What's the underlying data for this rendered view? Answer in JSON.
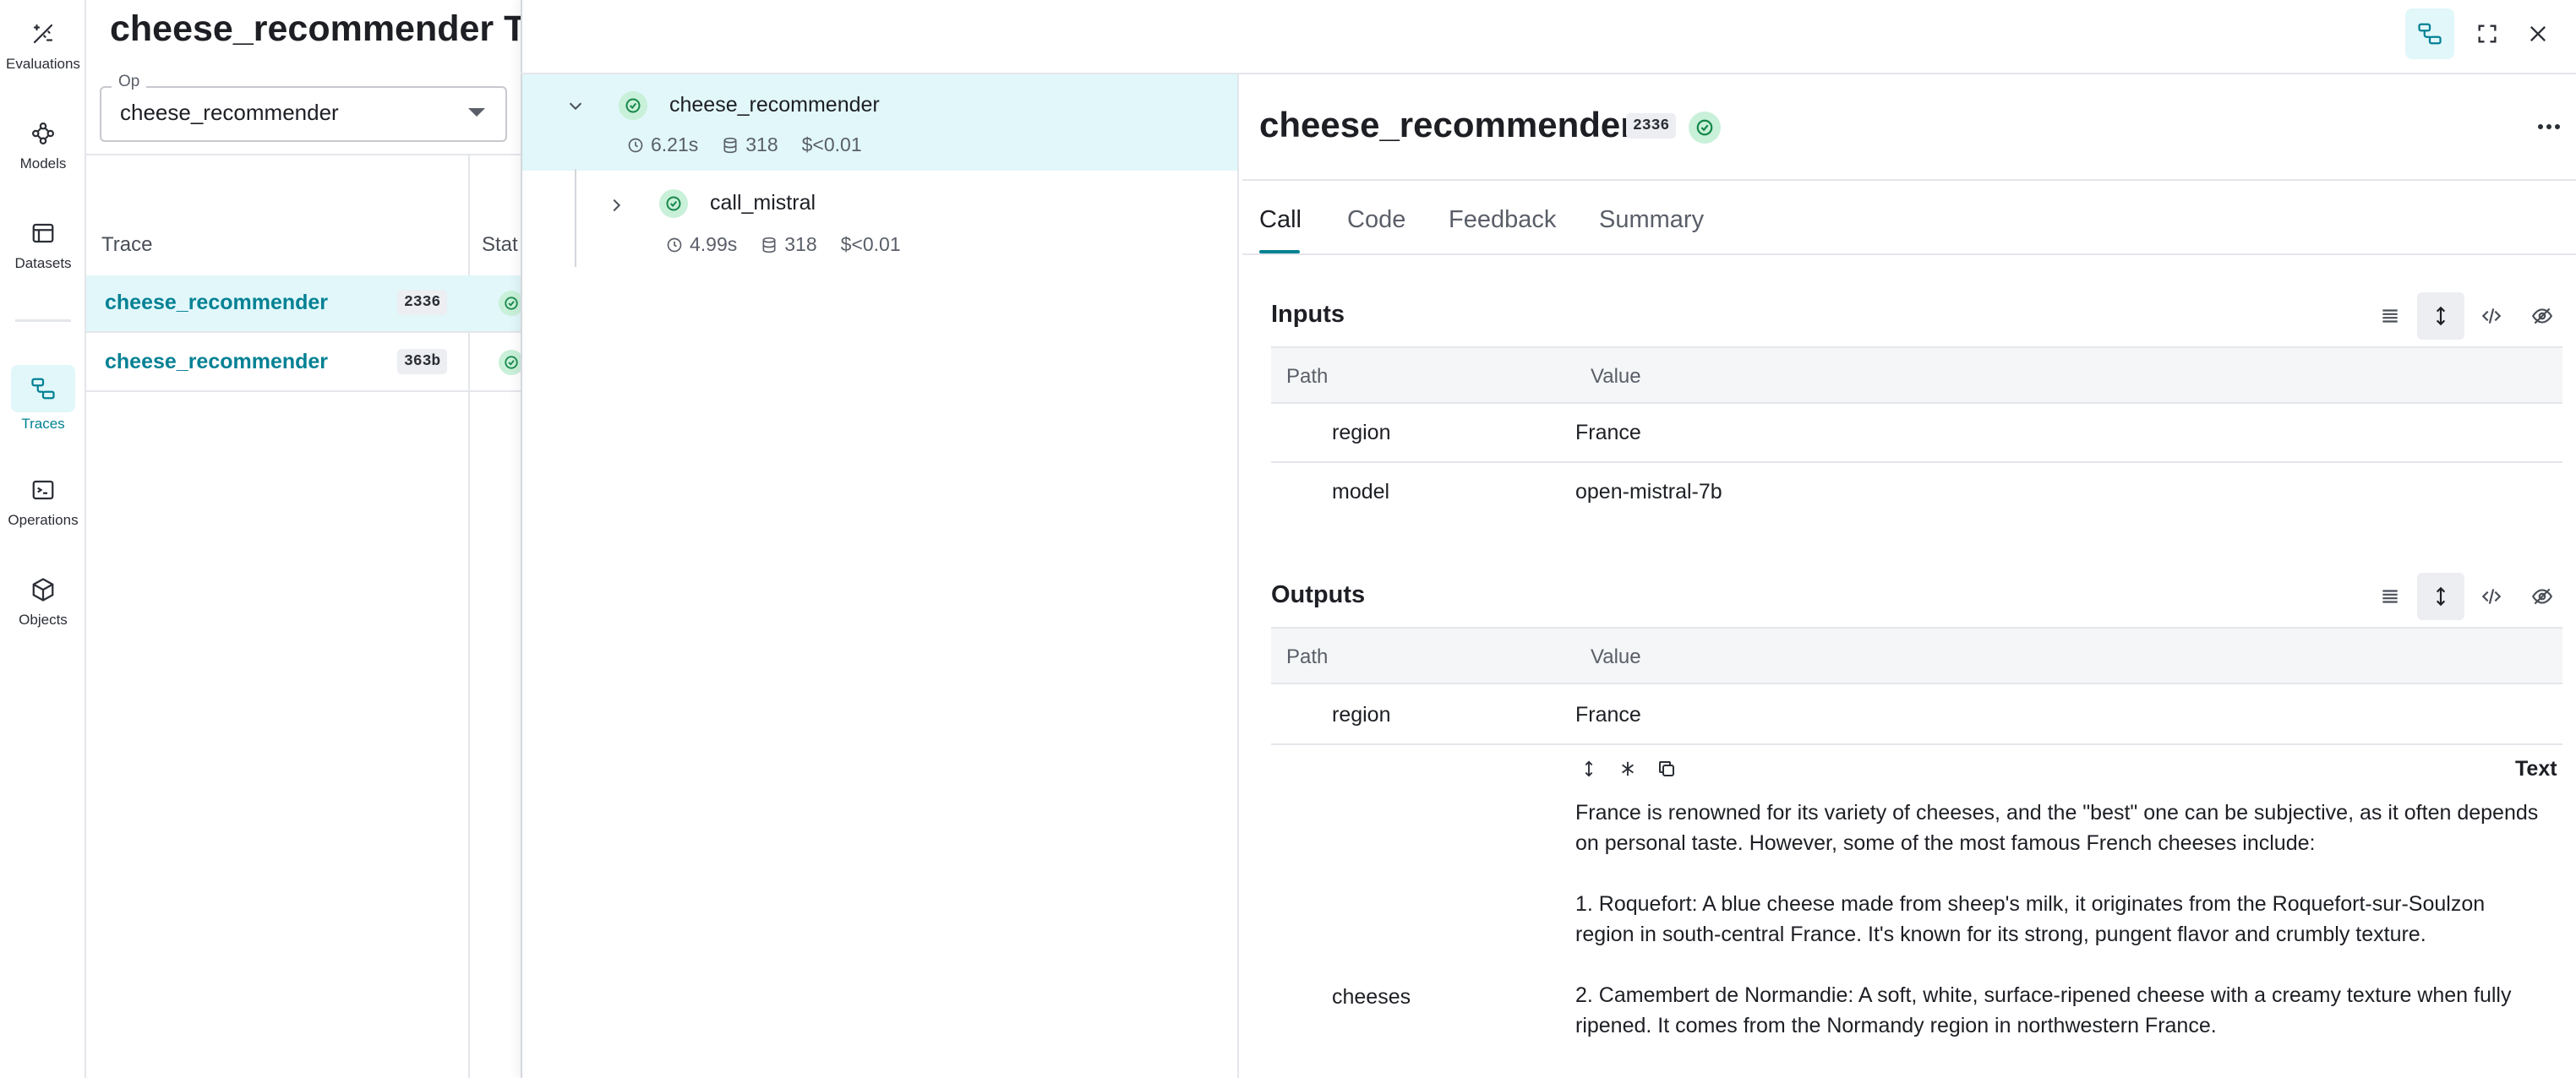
{
  "nav": {
    "items": [
      {
        "label": "Evaluations",
        "icon": "evaluations-icon"
      },
      {
        "label": "Models",
        "icon": "models-icon"
      },
      {
        "label": "Datasets",
        "icon": "datasets-icon"
      },
      {
        "label": "Traces",
        "icon": "traces-icon",
        "active": true
      },
      {
        "label": "Operations",
        "icon": "operations-icon"
      },
      {
        "label": "Objects",
        "icon": "objects-icon"
      }
    ]
  },
  "background_page": {
    "title": "cheese_recommender Tra",
    "op_filter": {
      "label": "Op",
      "value": "cheese_recommender"
    },
    "columns": {
      "trace": "Trace",
      "status": "Stat"
    },
    "rows": [
      {
        "name": "cheese_recommender",
        "badge": "2336"
      },
      {
        "name": "cheese_recommender",
        "badge": "363b"
      }
    ]
  },
  "trace_tree": {
    "root": {
      "name": "cheese_recommender",
      "latency": "6.21s",
      "tokens": "318",
      "cost": "$<0.01"
    },
    "child": {
      "name": "call_mistral",
      "latency": "4.99s",
      "tokens": "318",
      "cost": "$<0.01"
    }
  },
  "call": {
    "title": "cheese_recommender",
    "badge": "2336",
    "tabs": [
      "Call",
      "Code",
      "Feedback",
      "Summary"
    ],
    "inputs": {
      "title": "Inputs",
      "path_header": "Path",
      "value_header": "Value",
      "rows": [
        {
          "path": "region",
          "value": "France"
        },
        {
          "path": "model",
          "value": "open-mistral-7b"
        }
      ]
    },
    "outputs": {
      "title": "Outputs",
      "path_header": "Path",
      "value_header": "Value",
      "rows": [
        {
          "path": "region",
          "value": "France"
        },
        {
          "path": "cheeses"
        }
      ],
      "text_mode": "Text",
      "cheeses_text": [
        "France is renowned for its variety of cheeses, and the \"best\" one can be subjective, as it often depends on personal taste. However, some of the most famous French cheeses include:",
        "1. Roquefort: A blue cheese made from sheep's milk, it originates from the Roquefort-sur-Soulzon region in south-central France. It's known for its strong, pungent flavor and crumbly texture.",
        "2. Camembert de Normandie: A soft, white, surface-ripened cheese with a creamy texture when fully ripened. It comes from the Normandy region in northwestern France."
      ]
    }
  },
  "colors": {
    "accent": "#038194",
    "accent_bg": "#e1f7fa",
    "success": "#16884a",
    "success_bg": "#c9f0d9"
  }
}
